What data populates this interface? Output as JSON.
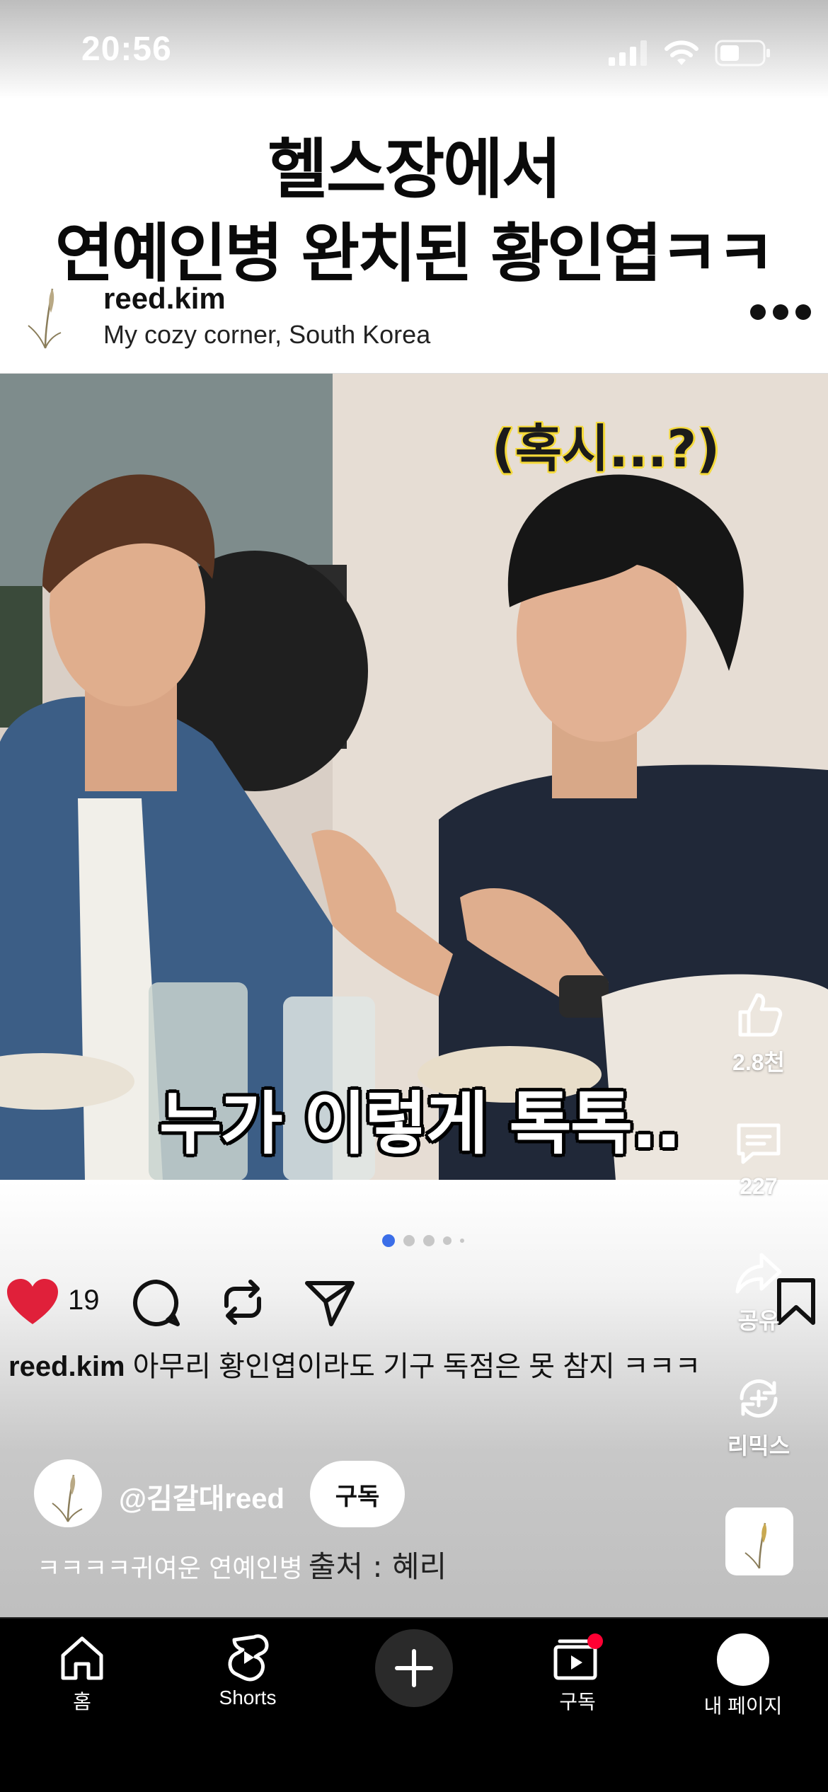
{
  "status_bar": {
    "time": "20:56"
  },
  "overlay_title": {
    "line1": "헬스장에서",
    "line2": "연예인병 완치된 황인엽ㅋㅋ"
  },
  "post": {
    "username": "reed.kim",
    "location": "My cozy corner, South Korea",
    "like_count": "19",
    "caption_user": "reed.kim",
    "caption_text": "아무리 황인엽이라도 기구 독점은 못 참지 ㅋㅋㅋ",
    "photo": {
      "caption_top": "(혹시...?)",
      "caption_bottom": "누가 이렇게 톡톡..",
      "caption_top_color": "#f4d93a"
    },
    "carousel_dots": 5,
    "active_dot": 0
  },
  "rail": {
    "like_count": "2.8천",
    "comment_count": "227",
    "share_label": "공유",
    "remix_label": "리믹스"
  },
  "channel": {
    "handle": "@김갈대reed",
    "subscribe_label": "구독",
    "caption": "ㅋㅋㅋㅋ귀여운 연예인병",
    "source": "출처 : 혜리"
  },
  "nav": {
    "home": "홈",
    "shorts": "Shorts",
    "subscriptions": "구독",
    "my_page": "내 페이지"
  },
  "colors": {
    "like_red": "#e0203a",
    "dot_active": "#3b6ee8",
    "nav_bg": "#000000",
    "notify_red": "#ff0033"
  }
}
